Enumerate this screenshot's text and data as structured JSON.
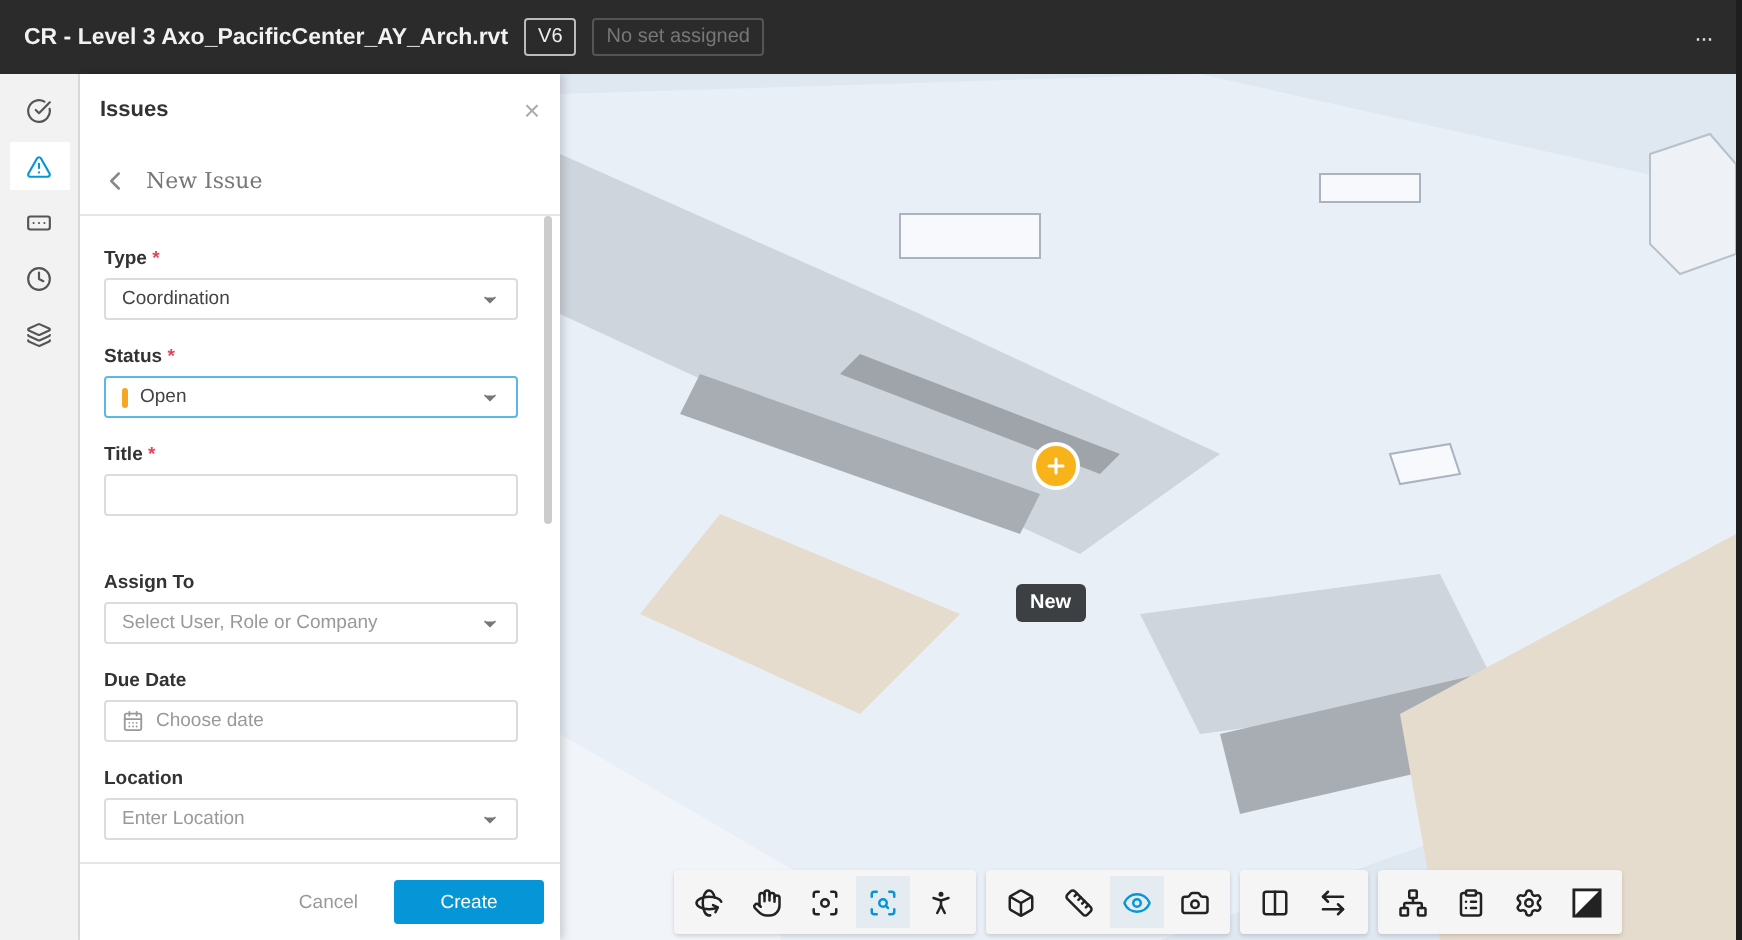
{
  "header": {
    "title": "CR - Level 3 Axo_PacificCenter_AY_Arch.rvt",
    "version": "V6",
    "set": "No set assigned",
    "more": "···"
  },
  "rail": [
    {
      "kind": "markup",
      "selected": false
    },
    {
      "kind": "issues",
      "selected": true
    },
    {
      "kind": "rfi",
      "selected": false
    },
    {
      "kind": "history",
      "selected": false
    },
    {
      "kind": "layers",
      "selected": false
    }
  ],
  "panel": {
    "title": "Issues",
    "close": "×",
    "subtitle": "New Issue",
    "fields": [
      {
        "kind": "select",
        "label": "Type",
        "required_mark": "*",
        "value": "Coordination",
        "focused": false
      },
      {
        "kind": "status",
        "label": "Status",
        "required_mark": "*",
        "value": "Open",
        "color": "#f5a623",
        "focused": true
      },
      {
        "kind": "input",
        "label": "Title",
        "required_mark": "*",
        "focused": false
      },
      {
        "kind": "divider"
      },
      {
        "kind": "select",
        "label": "Assign To",
        "placeholder": "Select User, Role or Company",
        "focused": false
      },
      {
        "kind": "date",
        "label": "Due Date",
        "placeholder": "Choose date",
        "focused": false
      },
      {
        "kind": "select",
        "label": "Location",
        "placeholder": "Enter Location",
        "focused": false
      }
    ],
    "cancel": "Cancel",
    "create": "Create"
  },
  "viewer": {
    "kind": "picture",
    "marker": {
      "tooltip": "New"
    },
    "toolbar": [
      [
        {
          "kind": "orbit",
          "selected": false
        },
        {
          "kind": "pan",
          "selected": false
        },
        {
          "kind": "fit",
          "selected": false
        },
        {
          "kind": "zoom",
          "selected": true
        },
        {
          "kind": "walk",
          "selected": false
        }
      ],
      [
        {
          "kind": "explode",
          "selected": false
        },
        {
          "kind": "measure",
          "selected": false
        },
        {
          "kind": "section",
          "selected": true
        },
        {
          "kind": "camera",
          "selected": false
        }
      ],
      [
        {
          "kind": "split",
          "selected": false
        },
        {
          "kind": "compare",
          "selected": false
        }
      ],
      [
        {
          "kind": "tree",
          "selected": false
        },
        {
          "kind": "properties",
          "selected": false
        },
        {
          "kind": "settings",
          "selected": false
        },
        {
          "kind": "fullscreen",
          "selected": false
        }
      ]
    ]
  }
}
